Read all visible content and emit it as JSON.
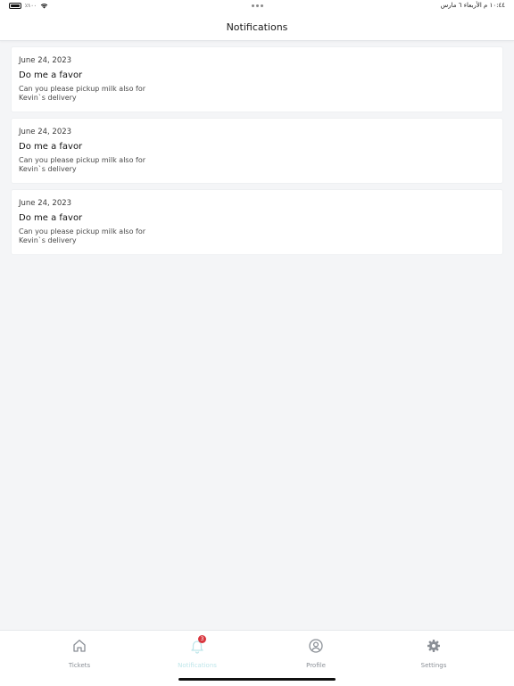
{
  "status_bar": {
    "battery_percent": "٪١٠٠",
    "time_date": "١٠:٤٤ م الأربعاء ٦ مارس"
  },
  "header": {
    "title": "Notifications"
  },
  "notifications": [
    {
      "date": "June 24, 2023",
      "title": "Do me a favor",
      "message": "Can you please pickup milk also for Kevin`s delivery"
    },
    {
      "date": "June 24, 2023",
      "title": "Do me a favor",
      "message": "Can you please pickup milk also for Kevin`s delivery"
    },
    {
      "date": "June 24, 2023",
      "title": "Do me a favor",
      "message": "Can you please pickup milk also for Kevin`s delivery"
    }
  ],
  "tab_bar": {
    "tabs": [
      {
        "label": "Tickets",
        "icon": "home-icon"
      },
      {
        "label": "Notifications",
        "icon": "bell-icon",
        "badge": "3",
        "active": true
      },
      {
        "label": "Profile",
        "icon": "profile-icon"
      },
      {
        "label": "Settings",
        "icon": "gear-icon"
      }
    ]
  },
  "colors": {
    "background": "#f4f5f7",
    "active_tab": "#bfe6ea",
    "inactive_tab": "#8a8f96",
    "badge": "#d9363e"
  }
}
